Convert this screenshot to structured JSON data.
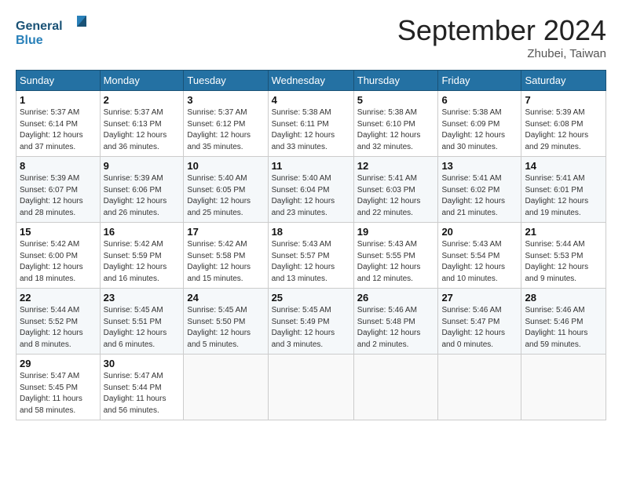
{
  "header": {
    "logo_line1": "General",
    "logo_line2": "Blue",
    "month_title": "September 2024",
    "location": "Zhubei, Taiwan"
  },
  "weekdays": [
    "Sunday",
    "Monday",
    "Tuesday",
    "Wednesday",
    "Thursday",
    "Friday",
    "Saturday"
  ],
  "weeks": [
    [
      {
        "day": "1",
        "info": "Sunrise: 5:37 AM\nSunset: 6:14 PM\nDaylight: 12 hours\nand 37 minutes."
      },
      {
        "day": "2",
        "info": "Sunrise: 5:37 AM\nSunset: 6:13 PM\nDaylight: 12 hours\nand 36 minutes."
      },
      {
        "day": "3",
        "info": "Sunrise: 5:37 AM\nSunset: 6:12 PM\nDaylight: 12 hours\nand 35 minutes."
      },
      {
        "day": "4",
        "info": "Sunrise: 5:38 AM\nSunset: 6:11 PM\nDaylight: 12 hours\nand 33 minutes."
      },
      {
        "day": "5",
        "info": "Sunrise: 5:38 AM\nSunset: 6:10 PM\nDaylight: 12 hours\nand 32 minutes."
      },
      {
        "day": "6",
        "info": "Sunrise: 5:38 AM\nSunset: 6:09 PM\nDaylight: 12 hours\nand 30 minutes."
      },
      {
        "day": "7",
        "info": "Sunrise: 5:39 AM\nSunset: 6:08 PM\nDaylight: 12 hours\nand 29 minutes."
      }
    ],
    [
      {
        "day": "8",
        "info": "Sunrise: 5:39 AM\nSunset: 6:07 PM\nDaylight: 12 hours\nand 28 minutes."
      },
      {
        "day": "9",
        "info": "Sunrise: 5:39 AM\nSunset: 6:06 PM\nDaylight: 12 hours\nand 26 minutes."
      },
      {
        "day": "10",
        "info": "Sunrise: 5:40 AM\nSunset: 6:05 PM\nDaylight: 12 hours\nand 25 minutes."
      },
      {
        "day": "11",
        "info": "Sunrise: 5:40 AM\nSunset: 6:04 PM\nDaylight: 12 hours\nand 23 minutes."
      },
      {
        "day": "12",
        "info": "Sunrise: 5:41 AM\nSunset: 6:03 PM\nDaylight: 12 hours\nand 22 minutes."
      },
      {
        "day": "13",
        "info": "Sunrise: 5:41 AM\nSunset: 6:02 PM\nDaylight: 12 hours\nand 21 minutes."
      },
      {
        "day": "14",
        "info": "Sunrise: 5:41 AM\nSunset: 6:01 PM\nDaylight: 12 hours\nand 19 minutes."
      }
    ],
    [
      {
        "day": "15",
        "info": "Sunrise: 5:42 AM\nSunset: 6:00 PM\nDaylight: 12 hours\nand 18 minutes."
      },
      {
        "day": "16",
        "info": "Sunrise: 5:42 AM\nSunset: 5:59 PM\nDaylight: 12 hours\nand 16 minutes."
      },
      {
        "day": "17",
        "info": "Sunrise: 5:42 AM\nSunset: 5:58 PM\nDaylight: 12 hours\nand 15 minutes."
      },
      {
        "day": "18",
        "info": "Sunrise: 5:43 AM\nSunset: 5:57 PM\nDaylight: 12 hours\nand 13 minutes."
      },
      {
        "day": "19",
        "info": "Sunrise: 5:43 AM\nSunset: 5:55 PM\nDaylight: 12 hours\nand 12 minutes."
      },
      {
        "day": "20",
        "info": "Sunrise: 5:43 AM\nSunset: 5:54 PM\nDaylight: 12 hours\nand 10 minutes."
      },
      {
        "day": "21",
        "info": "Sunrise: 5:44 AM\nSunset: 5:53 PM\nDaylight: 12 hours\nand 9 minutes."
      }
    ],
    [
      {
        "day": "22",
        "info": "Sunrise: 5:44 AM\nSunset: 5:52 PM\nDaylight: 12 hours\nand 8 minutes."
      },
      {
        "day": "23",
        "info": "Sunrise: 5:45 AM\nSunset: 5:51 PM\nDaylight: 12 hours\nand 6 minutes."
      },
      {
        "day": "24",
        "info": "Sunrise: 5:45 AM\nSunset: 5:50 PM\nDaylight: 12 hours\nand 5 minutes."
      },
      {
        "day": "25",
        "info": "Sunrise: 5:45 AM\nSunset: 5:49 PM\nDaylight: 12 hours\nand 3 minutes."
      },
      {
        "day": "26",
        "info": "Sunrise: 5:46 AM\nSunset: 5:48 PM\nDaylight: 12 hours\nand 2 minutes."
      },
      {
        "day": "27",
        "info": "Sunrise: 5:46 AM\nSunset: 5:47 PM\nDaylight: 12 hours\nand 0 minutes."
      },
      {
        "day": "28",
        "info": "Sunrise: 5:46 AM\nSunset: 5:46 PM\nDaylight: 11 hours\nand 59 minutes."
      }
    ],
    [
      {
        "day": "29",
        "info": "Sunrise: 5:47 AM\nSunset: 5:45 PM\nDaylight: 11 hours\nand 58 minutes."
      },
      {
        "day": "30",
        "info": "Sunrise: 5:47 AM\nSunset: 5:44 PM\nDaylight: 11 hours\nand 56 minutes."
      },
      null,
      null,
      null,
      null,
      null
    ]
  ]
}
